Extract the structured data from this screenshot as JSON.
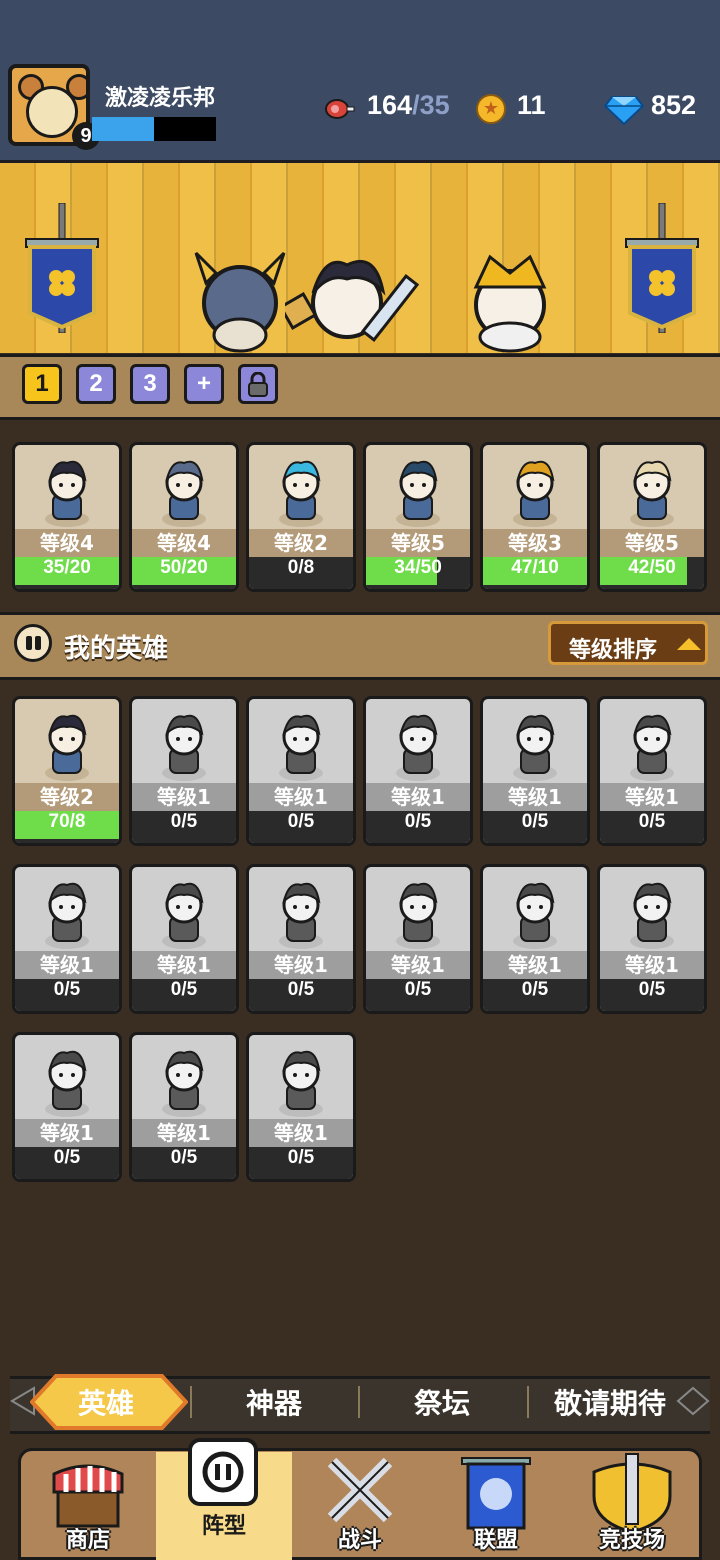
{
  "player": {
    "name": "激凌凌乐邦",
    "level": "9",
    "xp_fraction": 0.5
  },
  "resources": {
    "stamina_current": "164",
    "stamina_max": "/35",
    "coins": "11",
    "gems": "852"
  },
  "team_tabs": [
    {
      "label": "1",
      "active": true
    },
    {
      "label": "2"
    },
    {
      "label": "3"
    },
    {
      "label": "+"
    },
    {
      "icon": "lock-icon"
    }
  ],
  "team": [
    {
      "level": "等级4",
      "progress": "35/20",
      "fill": 1.0
    },
    {
      "level": "等级4",
      "progress": "50/20",
      "fill": 1.0
    },
    {
      "level": "等级2",
      "progress": "0/8",
      "fill": 0.0
    },
    {
      "level": "等级5",
      "progress": "34/50",
      "fill": 0.68
    },
    {
      "level": "等级3",
      "progress": "47/10",
      "fill": 1.0
    },
    {
      "level": "等级5",
      "progress": "42/50",
      "fill": 0.84
    }
  ],
  "my_heroes": {
    "title": "我的英雄",
    "sort_label": "等级排序",
    "heroes": [
      {
        "level": "等级2",
        "progress": "70/8",
        "fill": 1.0,
        "owned": true
      },
      {
        "level": "等级1",
        "progress": "0/5",
        "fill": 0.0,
        "owned": false
      },
      {
        "level": "等级1",
        "progress": "0/5",
        "fill": 0.0,
        "owned": false
      },
      {
        "level": "等级1",
        "progress": "0/5",
        "fill": 0.0,
        "owned": false
      },
      {
        "level": "等级1",
        "progress": "0/5",
        "fill": 0.0,
        "owned": false
      },
      {
        "level": "等级1",
        "progress": "0/5",
        "fill": 0.0,
        "owned": false
      },
      {
        "level": "等级1",
        "progress": "0/5",
        "fill": 0.0,
        "owned": false
      },
      {
        "level": "等级1",
        "progress": "0/5",
        "fill": 0.0,
        "owned": false
      },
      {
        "level": "等级1",
        "progress": "0/5",
        "fill": 0.0,
        "owned": false
      },
      {
        "level": "等级1",
        "progress": "0/5",
        "fill": 0.0,
        "owned": false
      },
      {
        "level": "等级1",
        "progress": "0/5",
        "fill": 0.0,
        "owned": false
      },
      {
        "level": "等级1",
        "progress": "0/5",
        "fill": 0.0,
        "owned": false
      },
      {
        "level": "等级1",
        "progress": "0/5",
        "fill": 0.0,
        "owned": false
      },
      {
        "level": "等级1",
        "progress": "0/5",
        "fill": 0.0,
        "owned": false
      },
      {
        "level": "等级1",
        "progress": "0/5",
        "fill": 0.0,
        "owned": false
      }
    ]
  },
  "sub_tabs": [
    "英雄",
    "神器",
    "祭坛",
    "敬请期待"
  ],
  "nav": [
    {
      "label": "商店",
      "icon": "shop-icon"
    },
    {
      "label": "阵型",
      "icon": "formation-icon",
      "active": true
    },
    {
      "label": "战斗",
      "icon": "crossed-swords-icon"
    },
    {
      "label": "联盟",
      "icon": "alliance-banner-icon"
    },
    {
      "label": "竞技场",
      "icon": "arena-shield-icon"
    }
  ],
  "colors": {
    "accent": "#f6c41b",
    "progress_green": "#6fdc4a",
    "xp_blue": "#3aa3ec",
    "topbar": "#3c4a63"
  }
}
